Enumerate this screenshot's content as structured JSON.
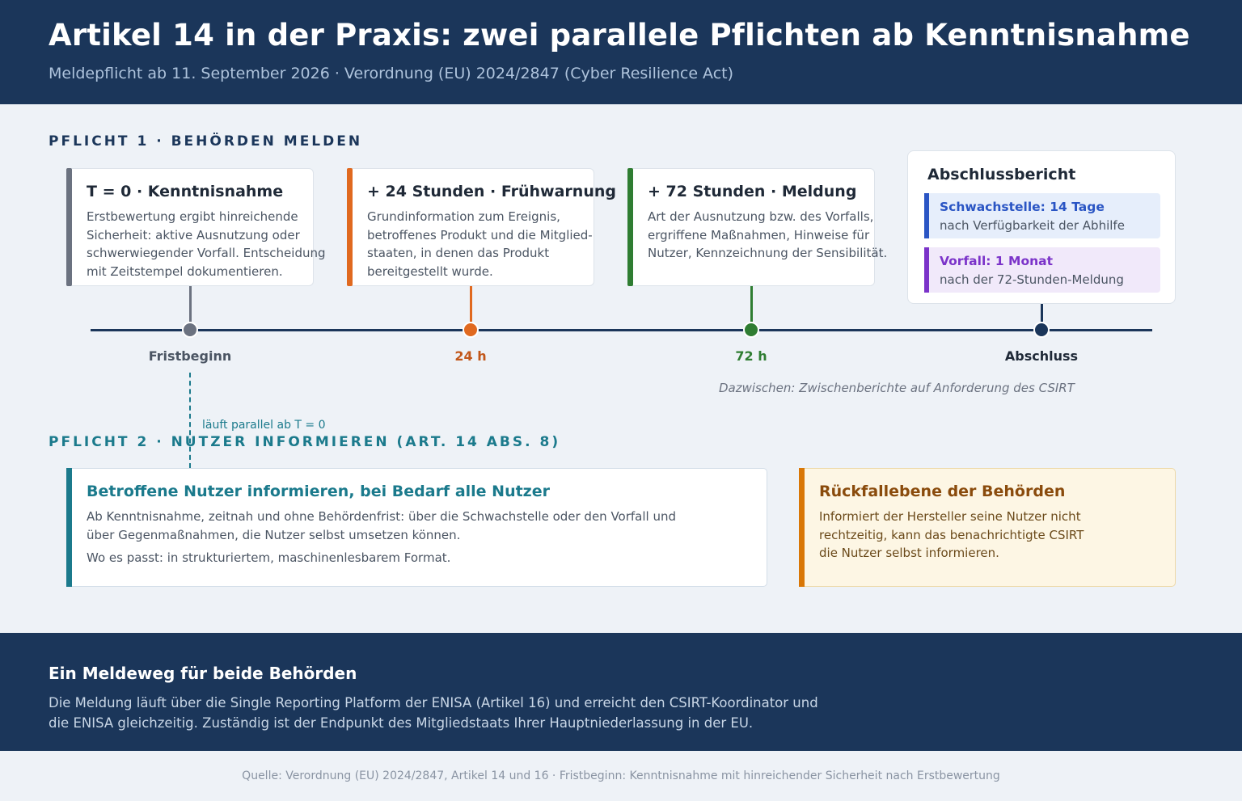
{
  "header": {
    "title": "Artikel 14 in der Praxis: zwei parallele Pflichten ab Kenntnisnahme",
    "subtitle": "Meldepflicht ab 11. September 2026 · Verordnung (EU) 2024/2847 (Cyber Resilience Act)"
  },
  "section1": {
    "label": "PFLICHT 1 · BEHÖRDEN MELDEN"
  },
  "cards": [
    {
      "title": "T = 0 · Kenntnisnahme",
      "text": "Erstbewertung ergibt hinreichende Sicherheit: aktive Ausnutzung oder schwerwiegender Vorfall. Entscheidung mit Zeitstempel dokumentieren.",
      "color": "#6b7280"
    },
    {
      "title": "+ 24 Stunden · Frühwarnung",
      "text": "Grundinformation zum Ereignis, betroffenes Produkt und die Mitglied-staaten, in denen das Produkt bereitgestellt wurde.",
      "color": "#e0691f"
    },
    {
      "title": "+ 72 Stunden · Meldung",
      "text": "Art der Ausnutzung bzw. des Vorfalls, ergriffene Maßnahmen, Hinweise für Nutzer, Kennzeichnung der Sensibilität.",
      "color": "#2f7d32"
    }
  ],
  "final_report": {
    "title": "Abschlussbericht",
    "items": [
      {
        "title": "Schwachstelle: 14 Tage",
        "text": "nach Verfügbarkeit der Abhilfe"
      },
      {
        "title": "Vorfall: 1 Monat",
        "text": "nach der 72-Stunden-Meldung"
      }
    ]
  },
  "timeline": {
    "labels": [
      "Fristbeginn",
      "24 h",
      "72 h",
      "Abschluss"
    ],
    "note": "Dazwischen: Zwischenberichte auf Anforderung des CSIRT"
  },
  "section2": {
    "label": "PFLICHT 2 · NUTZER INFORMIEREN (ART. 14 ABS. 8)",
    "parallel_note": "läuft parallel ab T = 0"
  },
  "users_card": {
    "title": "Betroffene Nutzer informieren, bei Bedarf alle Nutzer",
    "text1": "Ab Kenntnisnahme, zeitnah und ohne Behördenfrist: über die Schwachstelle oder den Vorfall und über Gegenmaßnahmen, die Nutzer selbst umsetzen können.",
    "text2": "Wo es passt: in strukturiertem, maschinenlesbarem Format."
  },
  "fallback_card": {
    "title": "Rückfallebene der Behörden",
    "text": "Informiert der Hersteller seine Nutzer nicht rechtzeitig, kann das benachrichtigte CSIRT die Nutzer selbst informieren."
  },
  "footer": {
    "title": "Ein Meldeweg für beide Behörden",
    "text": "Die Meldung läuft über die Single Reporting Platform der ENISA (Artikel 16) und erreicht den CSIRT-Koordinator und die ENISA gleichzeitig. Zuständig ist der Endpunkt des Mitgliedstaats Ihrer Hauptniederlassung in der EU."
  },
  "source": "Quelle: Verordnung (EU) 2024/2847, Artikel 14 und 16 · Fristbeginn: Kenntnisnahme mit hinreichender Sicherheit nach Erstbewertung",
  "colors": {
    "navy": "#1b365a",
    "gray": "#6b7280",
    "orange": "#e0691f",
    "green": "#2f7d32",
    "teal": "#1b7a8c",
    "blue": "#2a55c4",
    "purple": "#7b33c9"
  }
}
